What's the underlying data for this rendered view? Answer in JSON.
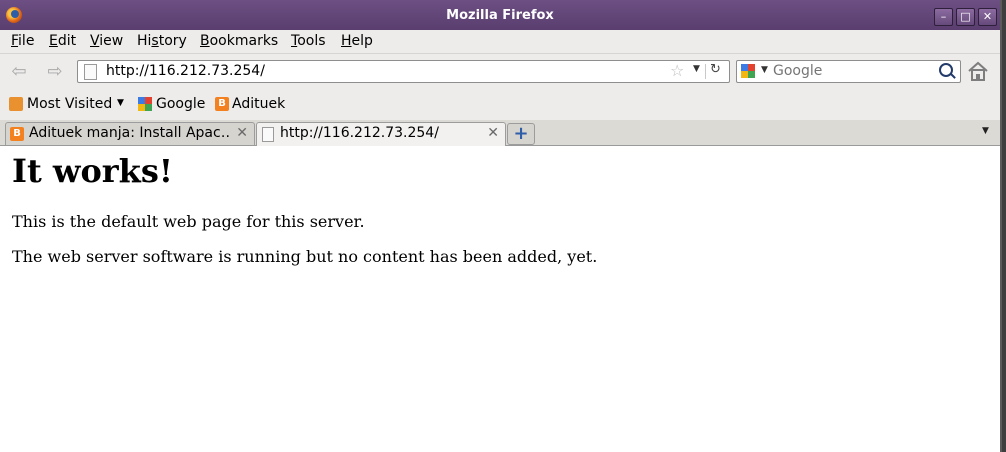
{
  "window": {
    "title": "Mozilla Firefox",
    "controls": [
      "minimize",
      "maximize",
      "close"
    ]
  },
  "menu": [
    {
      "label": "File",
      "accel": "F",
      "rest": "ile"
    },
    {
      "label": "Edit",
      "accel": "E",
      "rest": "dit"
    },
    {
      "label": "View",
      "accel": "V",
      "rest": "iew"
    },
    {
      "label": "History",
      "pre": "Hi",
      "accel": "s",
      "rest": "tory"
    },
    {
      "label": "Bookmarks",
      "accel": "B",
      "rest": "ookmarks"
    },
    {
      "label": "Tools",
      "accel": "T",
      "rest": "ools"
    },
    {
      "label": "Help",
      "accel": "H",
      "rest": "elp"
    }
  ],
  "navigation": {
    "url": "http://116.212.73.254/",
    "search_placeholder": "Google"
  },
  "bookmarks": [
    {
      "label": "Most Visited",
      "icon": "rss-folder-icon",
      "has_dropdown": true
    },
    {
      "label": "Google",
      "icon": "google-icon"
    },
    {
      "label": "Adituek",
      "icon": "blogger-icon"
    }
  ],
  "tabs": [
    {
      "label": "Adituek manja: Install Apac…",
      "icon": "blogger-icon",
      "active": false
    },
    {
      "label": "http://116.212.73.254/",
      "icon": "page-icon",
      "active": true
    }
  ],
  "page": {
    "heading": "It works!",
    "paragraphs": [
      "This is the default web page for this server.",
      "The web server software is running but no content has been added, yet."
    ]
  },
  "colors": {
    "titlebar": "#5a3e6f",
    "blogger": "#f4811f"
  }
}
